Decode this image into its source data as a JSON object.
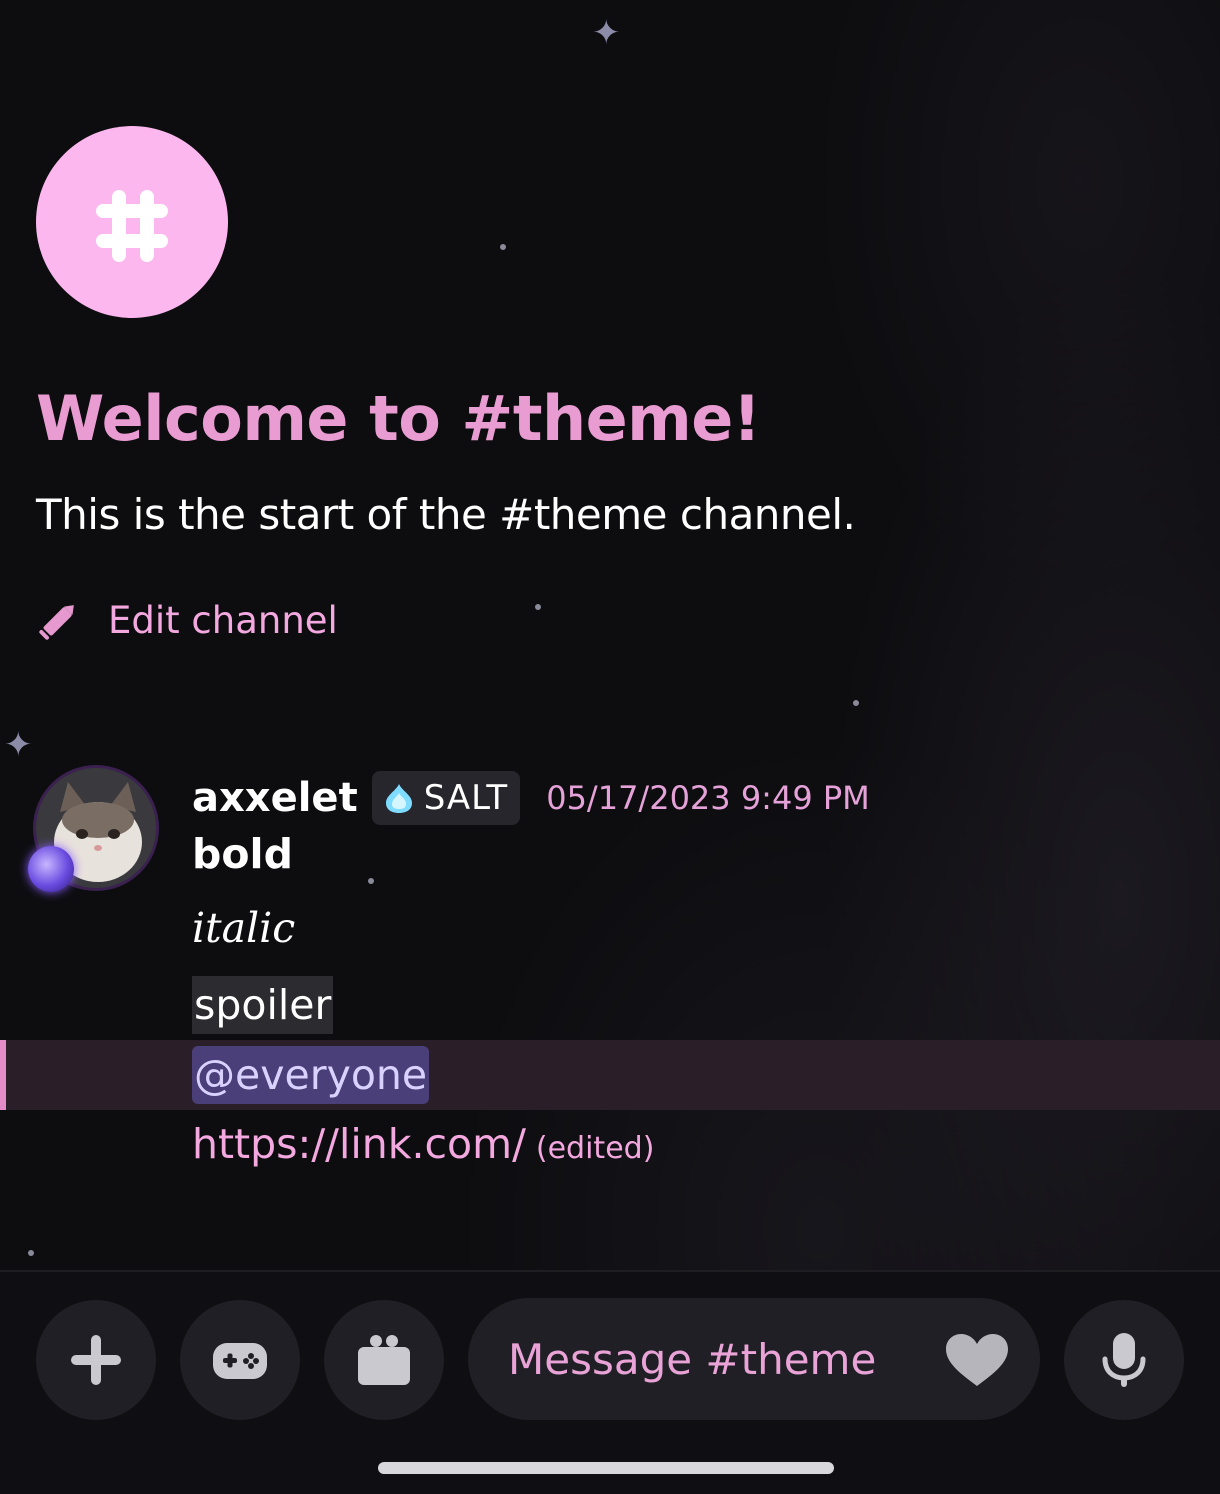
{
  "welcome": {
    "title": "Welcome to #theme!",
    "subtitle": "This is the start of the #theme channel.",
    "edit_label": "Edit channel"
  },
  "message": {
    "username": "axxelet",
    "clan_tag": "SALT",
    "timestamp": "05/17/2023 9:49 PM",
    "lines": {
      "bold": "bold",
      "italic": "italic",
      "spoiler": "spoiler",
      "mention": "@everyone",
      "link": "https://link.com/",
      "edited": "(edited)"
    }
  },
  "composer": {
    "placeholder": "Message #theme"
  },
  "colors": {
    "accent_pink": "#e99cd1",
    "channel_icon_bg": "#fbb7ee",
    "mention_bg": "#4a3f78",
    "background": "#0d0d10"
  },
  "icons": [
    "hashtag-icon",
    "pencil-icon",
    "clan-icon",
    "plus-icon",
    "gamepad-icon",
    "gift-icon",
    "heart-icon",
    "microphone-icon"
  ]
}
